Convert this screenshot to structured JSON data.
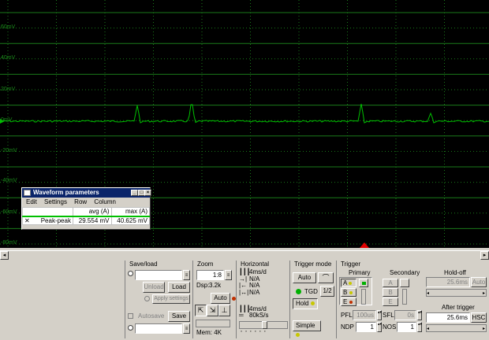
{
  "scope": {
    "y_labels": [
      "60mV",
      "40mV",
      "20mV",
      "0mV",
      "-20mV",
      "-40mV",
      "-60mV",
      "-80mV"
    ],
    "trace_color": "#00c000",
    "grid_color": "#1a7a1a",
    "trigger_marker_color": "#e00000"
  },
  "waveform_params": {
    "title": "Waveform parameters",
    "menu": [
      "Edit",
      "Settings",
      "Row",
      "Column"
    ],
    "columns": [
      "avg (A)",
      "max (A)"
    ],
    "row": {
      "icon": "close-icon",
      "name": "Peak-peak",
      "avg": "29.554 mV",
      "max": "40.625 mV"
    }
  },
  "saveload": {
    "title": "Save/load",
    "unload": "Unload",
    "load": "Load",
    "apply": "Apply settings",
    "autosave": "Autosave",
    "save": "Save"
  },
  "zoom": {
    "title": "Zoom",
    "value": "1:8",
    "dsp": "Dsp:",
    "dsp_value": "3.2k",
    "auto": "Auto",
    "mem": "Mem: 4K"
  },
  "horizontal": {
    "title": "Horizontal",
    "timebase": "4ms/d",
    "na1": "N/A",
    "na2": "N/A",
    "na3": "N/A",
    "timebase2": "4ms/d",
    "rate": "80kS/s"
  },
  "trigger_mode": {
    "title": "Trigger mode",
    "auto": "Auto",
    "tgd": "TGD",
    "half": "1/2",
    "hold": "Hold",
    "simple": "Simple"
  },
  "trigger": {
    "title": "Trigger",
    "primary": "Primary",
    "secondary": "Secondary",
    "holdoff": "Hold-off",
    "holdoff_value": "25.6ms",
    "auto": "Auto",
    "channels": [
      "A",
      "B",
      "E"
    ],
    "pfl": "PFL",
    "pfl_value": "100us",
    "sfl": "SFL",
    "sfl_value": "0s",
    "ndp": "NDP",
    "ndp_value": "1",
    "nos": "NOS",
    "nos_value": "1",
    "after": "After trigger",
    "after_value": "25.6ms",
    "hsc": "HSC"
  }
}
